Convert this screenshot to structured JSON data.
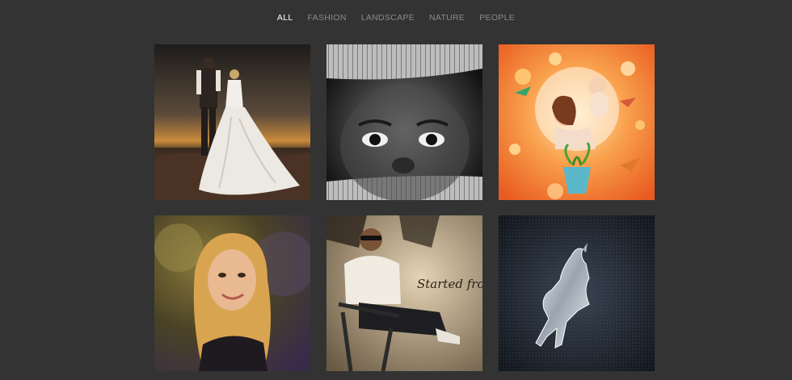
{
  "filters": {
    "items": [
      {
        "label": "ALL",
        "active": true
      },
      {
        "label": "FASHION",
        "active": false
      },
      {
        "label": "LANDSCAPE",
        "active": false
      },
      {
        "label": "NATURE",
        "active": false
      },
      {
        "label": "PEOPLE",
        "active": false
      }
    ]
  },
  "gallery": {
    "items": [
      {
        "subject": "wedding-couple-sunset-photo"
      },
      {
        "subject": "child-face-bw-photo"
      },
      {
        "subject": "mother-baby-fantasy-illustration"
      },
      {
        "subject": "blonde-woman-portrait-photo"
      },
      {
        "subject": "man-sunglasses-chair-photo",
        "graffiti_text": "Started from the Bottom"
      },
      {
        "subject": "prancing-horse-emblem-photo"
      }
    ]
  }
}
